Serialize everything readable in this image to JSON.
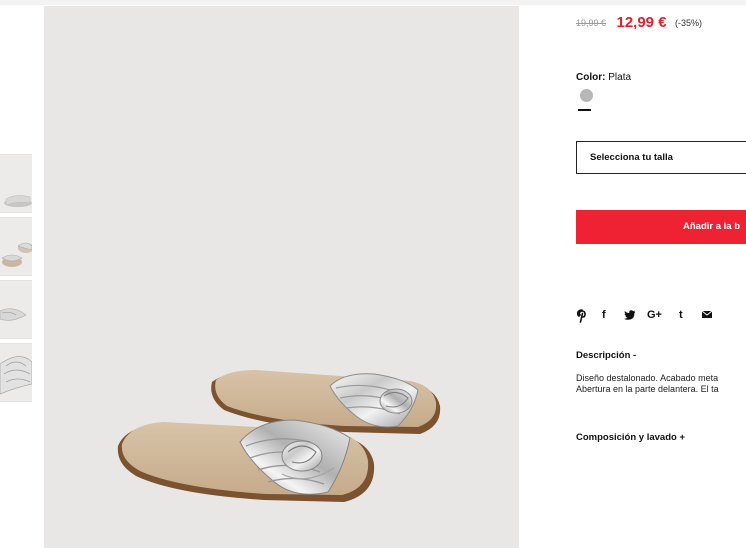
{
  "product": {
    "old_price": "19,99 €",
    "new_price": "12,99 €",
    "discount": "(-35%)",
    "color_label": "Color:",
    "color_value": "Plata",
    "size_placeholder": "Selecciona tu talla",
    "add_to_bag": "Añadir a la b",
    "description_title": "Descripción -",
    "description_lines": [
      "Diseño destalonado. Acabado meta",
      "Abertura en la parte delantera. El ta"
    ],
    "composition_title": "Composición y lavado +"
  },
  "share": {
    "icons": [
      "pinterest-icon",
      "facebook-icon",
      "twitter-icon",
      "google-plus-icon",
      "tumblr-icon",
      "email-icon"
    ],
    "glyphs": [
      "℗",
      "f",
      "♥",
      "G+",
      "t",
      "✉"
    ]
  },
  "colors": {
    "accent": "#ef2233",
    "price": "#e0222e",
    "swatch_silver": "#b7b7b7"
  }
}
